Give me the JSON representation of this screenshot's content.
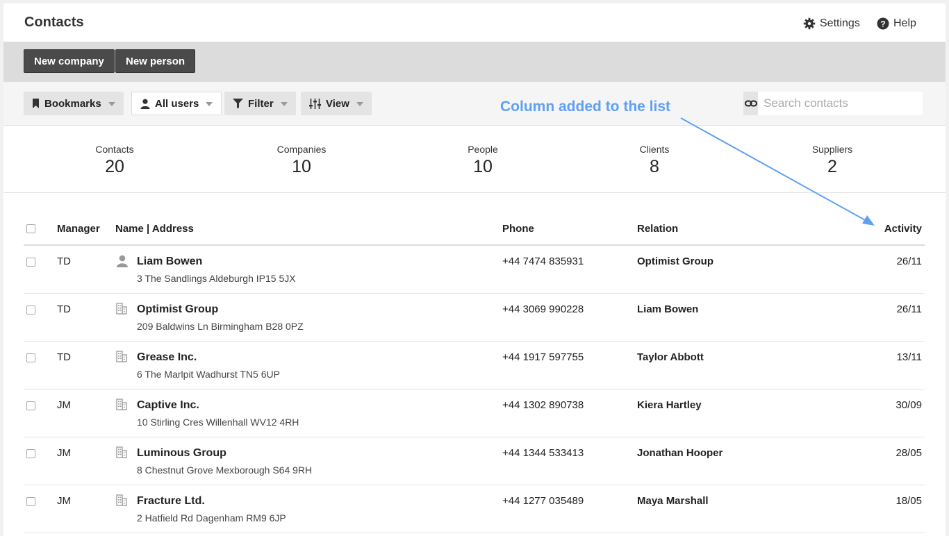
{
  "header": {
    "title": "Contacts",
    "settings_label": "Settings",
    "help_label": "Help"
  },
  "actions": {
    "new_company": "New company",
    "new_person": "New person"
  },
  "toolbar": {
    "bookmarks": "Bookmarks",
    "all_users": "All users",
    "filter": "Filter",
    "view": "View",
    "annotation": "Column added to the list",
    "search_placeholder": "Search contacts"
  },
  "stats": [
    {
      "label": "Contacts",
      "value": "20"
    },
    {
      "label": "Companies",
      "value": "10"
    },
    {
      "label": "People",
      "value": "10"
    },
    {
      "label": "Clients",
      "value": "8"
    },
    {
      "label": "Suppliers",
      "value": "2"
    }
  ],
  "table": {
    "columns": {
      "manager": "Manager",
      "name": "Name | Address",
      "phone": "Phone",
      "relation": "Relation",
      "activity": "Activity"
    },
    "rows": [
      {
        "type": "person-icon",
        "manager": "TD",
        "name": "Liam Bowen",
        "address": "3 The Sandlings Aldeburgh IP15 5JX",
        "phone": "+44 7474 835931",
        "relation": "Optimist Group",
        "activity": "26/11"
      },
      {
        "type": "building-icon",
        "manager": "TD",
        "name": "Optimist Group",
        "address": "209 Baldwins Ln Birmingham B28 0PZ",
        "phone": "+44 3069 990228",
        "relation": "Liam Bowen",
        "activity": "26/11"
      },
      {
        "type": "building-icon",
        "manager": "TD",
        "name": "Grease Inc.",
        "address": "6 The Marlpit Wadhurst TN5 6UP",
        "phone": "+44 1917 597755",
        "relation": "Taylor Abbott",
        "activity": "13/11"
      },
      {
        "type": "building-icon",
        "manager": "JM",
        "name": "Captive Inc.",
        "address": "10 Stirling Cres Willenhall WV12 4RH",
        "phone": "+44 1302 890738",
        "relation": "Kiera Hartley",
        "activity": "30/09"
      },
      {
        "type": "building-icon",
        "manager": "JM",
        "name": "Luminous Group",
        "address": "8 Chestnut Grove Mexborough S64 9RH",
        "phone": "+44 1344 533413",
        "relation": "Jonathan Hooper",
        "activity": "28/05"
      },
      {
        "type": "building-icon",
        "manager": "JM",
        "name": "Fracture Ltd.",
        "address": "2 Hatfield Rd Dagenham RM9 6JP",
        "phone": "+44 1277 035489",
        "relation": "Maya Marshall",
        "activity": "18/05"
      }
    ]
  },
  "colors": {
    "annotation": "#5fa0f5",
    "dark_button": "#4a4a4a",
    "action_bar": "#dcdcdc"
  }
}
